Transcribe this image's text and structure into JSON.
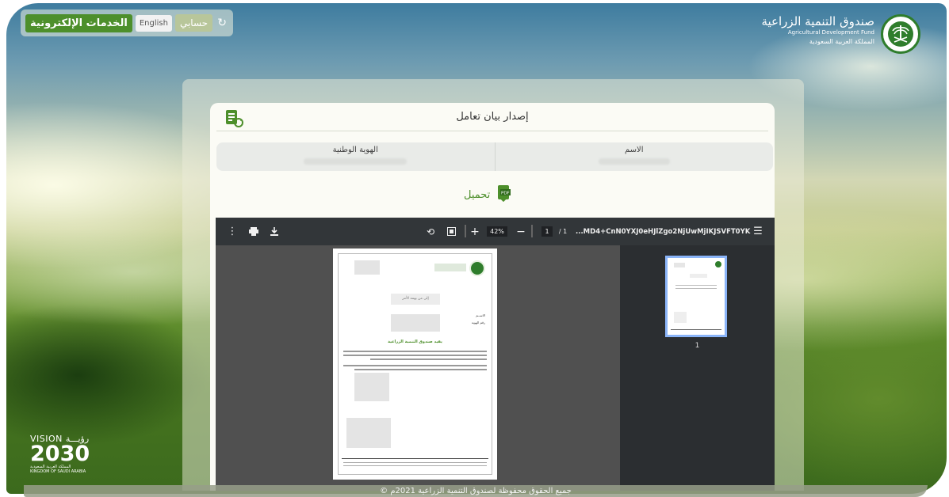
{
  "nav": {
    "eservices": "الخدمات الإلكترونية",
    "english": "English",
    "account": "حسابي"
  },
  "logo": {
    "name_ar": "صندوق التنمية الزراعية",
    "name_en": "Agricultural Development Fund",
    "country_ar": "المملكة العربية السعودية"
  },
  "card": {
    "title": "إصدار بيان تعامل",
    "name_label": "الاسم",
    "id_label": "الهوية الوطنية",
    "download_label": "تحميل"
  },
  "viewer": {
    "filename": "...MD4+CnN0YXJ0eHJlZgo2NjUwMjIKJSVFT0YK",
    "page_current": "1",
    "page_total": "/ 1",
    "zoom": "42%",
    "thumb_number": "1"
  },
  "doc": {
    "subject": "إلى من يهمه الأمر",
    "field_name": "الاســم",
    "field_id": "رقم الهوية",
    "heading": "يفيد صندوق التنمية الزراعية"
  },
  "vision": {
    "top": "VISION رؤيـــة",
    "year": "2030",
    "sub1": "المملكة العربية السعودية",
    "sub2": "KINGDOM OF SAUDI ARABIA"
  },
  "footer": {
    "copyright": "© جميع الحقوق محفوظة لصندوق التنمية الزراعية 2021م"
  },
  "colors": {
    "brand_green": "#4d8f2b",
    "toolbar": "#323639",
    "viewer_bg": "#505050"
  }
}
